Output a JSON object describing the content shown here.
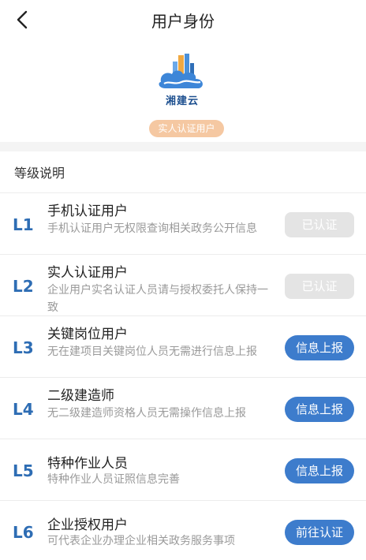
{
  "header": {
    "title": "用户身份"
  },
  "logo": {
    "text": "湘建云"
  },
  "badge": "实人认证用户",
  "section_title": "等级说明",
  "levels": [
    {
      "level": "L1",
      "title": "手机认证用户",
      "desc": "手机认证用户无权限查询相关政务公开信息",
      "button": "已认证",
      "status": "done"
    },
    {
      "level": "L2",
      "title": "实人认证用户",
      "desc": "企业用户实名认证人员请与授权委托人保持一致",
      "button": "已认证",
      "status": "done"
    },
    {
      "level": "L3",
      "title": "关键岗位用户",
      "desc": "无在建项目关键岗位人员无需进行信息上报",
      "button": "信息上报",
      "status": "action"
    },
    {
      "level": "L4",
      "title": "二级建造师",
      "desc": "无二级建造师资格人员无需操作信息上报",
      "button": "信息上报",
      "status": "action"
    },
    {
      "level": "L5",
      "title": "特种作业人员",
      "desc": "特种作业人员证照信息完善",
      "button": "信息上报",
      "status": "action"
    },
    {
      "level": "L6",
      "title": "企业授权用户",
      "desc": "可代表企业办理企业相关政务服务事项",
      "button": "前往认证",
      "status": "action"
    }
  ],
  "colors": {
    "accent": "#3d7ccc",
    "level_text": "#2e6db4",
    "badge_bg": "#f5c8a2",
    "disabled_btn": "#e4e4e4"
  }
}
